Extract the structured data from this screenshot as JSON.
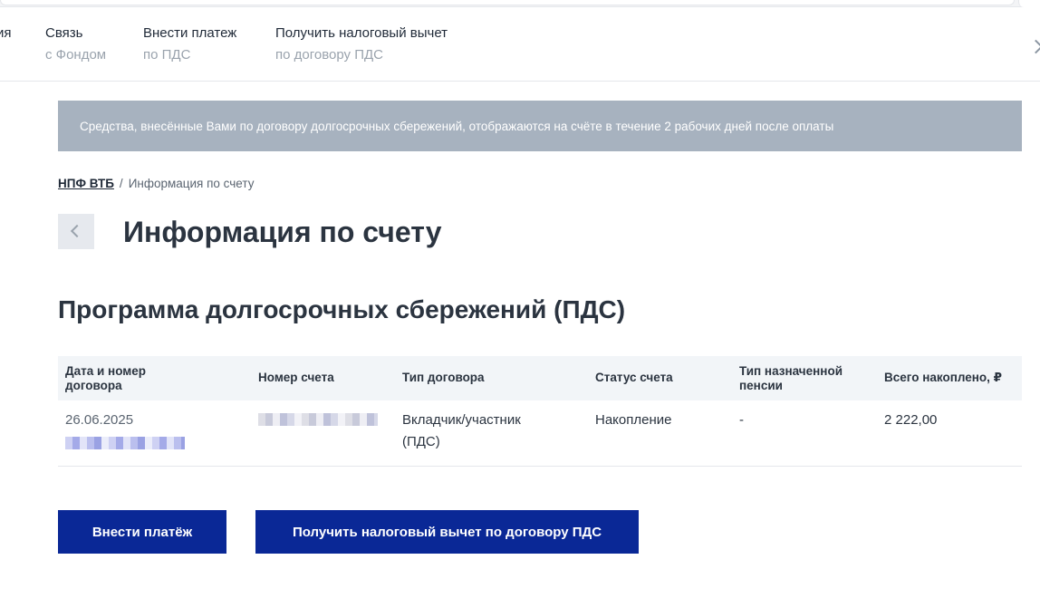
{
  "nav": {
    "items": [
      {
        "line1": "ия",
        "line2": ""
      },
      {
        "line1": "Связь",
        "line2": "с Фондом"
      },
      {
        "line1": "Внести платеж",
        "line2": "по ПДС"
      },
      {
        "line1": "Получить налоговый вычет",
        "line2": "по договору ПДС"
      }
    ]
  },
  "banner": {
    "text": "Средства, внесённые Вами по договору долгосрочных сбережений, отображаются на счёте в течение 2 рабочих дней после оплаты"
  },
  "breadcrumb": {
    "root": "НПФ ВТБ",
    "separator": "/",
    "current": "Информация по счету"
  },
  "page": {
    "title": "Информация по счету",
    "section_title": "Программа долгосрочных сбережений (ПДС)"
  },
  "table": {
    "headers": [
      {
        "line1": "Дата и номер",
        "line2": "договора"
      },
      {
        "line1": "Номер счета",
        "line2": ""
      },
      {
        "line1": "Тип договора",
        "line2": ""
      },
      {
        "line1": "Статус счета",
        "line2": ""
      },
      {
        "line1": "Тип назначенной",
        "line2": "пенсии"
      },
      {
        "line1": "Всего накоплено, ₽",
        "line2": ""
      }
    ],
    "rows": [
      {
        "date": "26.06.2025",
        "contract_type_line1": "Вкладчик/участник",
        "contract_type_line2": "(ПДС)",
        "status": "Накопление",
        "pension_type": "-",
        "total": "2 222,00"
      }
    ]
  },
  "buttons": {
    "pay": "Внести платёж",
    "tax": "Получить налоговый вычет по договору ПДС"
  },
  "colors": {
    "primary": "#0a2896",
    "banner_bg": "#a7b2bf",
    "table_header_bg": "#f2f5f8"
  }
}
